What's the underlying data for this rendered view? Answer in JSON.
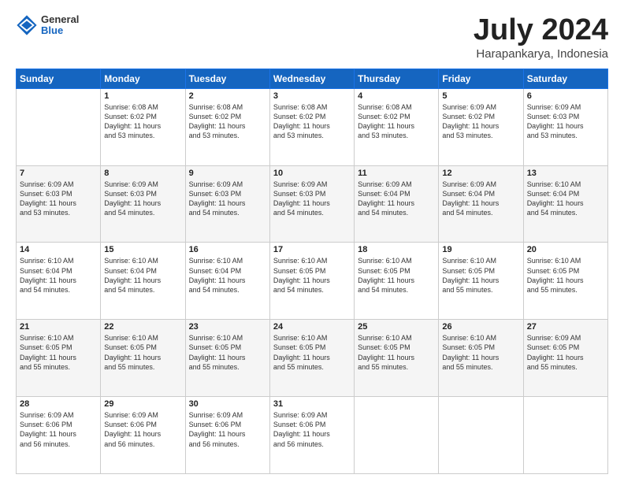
{
  "header": {
    "logo_line1": "General",
    "logo_line2": "Blue",
    "main_title": "July 2024",
    "subtitle": "Harapankarya, Indonesia"
  },
  "calendar": {
    "days_of_week": [
      "Sunday",
      "Monday",
      "Tuesday",
      "Wednesday",
      "Thursday",
      "Friday",
      "Saturday"
    ],
    "weeks": [
      [
        {
          "num": "",
          "lines": []
        },
        {
          "num": "1",
          "lines": [
            "Sunrise: 6:08 AM",
            "Sunset: 6:02 PM",
            "Daylight: 11 hours",
            "and 53 minutes."
          ]
        },
        {
          "num": "2",
          "lines": [
            "Sunrise: 6:08 AM",
            "Sunset: 6:02 PM",
            "Daylight: 11 hours",
            "and 53 minutes."
          ]
        },
        {
          "num": "3",
          "lines": [
            "Sunrise: 6:08 AM",
            "Sunset: 6:02 PM",
            "Daylight: 11 hours",
            "and 53 minutes."
          ]
        },
        {
          "num": "4",
          "lines": [
            "Sunrise: 6:08 AM",
            "Sunset: 6:02 PM",
            "Daylight: 11 hours",
            "and 53 minutes."
          ]
        },
        {
          "num": "5",
          "lines": [
            "Sunrise: 6:09 AM",
            "Sunset: 6:02 PM",
            "Daylight: 11 hours",
            "and 53 minutes."
          ]
        },
        {
          "num": "6",
          "lines": [
            "Sunrise: 6:09 AM",
            "Sunset: 6:03 PM",
            "Daylight: 11 hours",
            "and 53 minutes."
          ]
        }
      ],
      [
        {
          "num": "7",
          "lines": [
            "Sunrise: 6:09 AM",
            "Sunset: 6:03 PM",
            "Daylight: 11 hours",
            "and 53 minutes."
          ]
        },
        {
          "num": "8",
          "lines": [
            "Sunrise: 6:09 AM",
            "Sunset: 6:03 PM",
            "Daylight: 11 hours",
            "and 54 minutes."
          ]
        },
        {
          "num": "9",
          "lines": [
            "Sunrise: 6:09 AM",
            "Sunset: 6:03 PM",
            "Daylight: 11 hours",
            "and 54 minutes."
          ]
        },
        {
          "num": "10",
          "lines": [
            "Sunrise: 6:09 AM",
            "Sunset: 6:03 PM",
            "Daylight: 11 hours",
            "and 54 minutes."
          ]
        },
        {
          "num": "11",
          "lines": [
            "Sunrise: 6:09 AM",
            "Sunset: 6:04 PM",
            "Daylight: 11 hours",
            "and 54 minutes."
          ]
        },
        {
          "num": "12",
          "lines": [
            "Sunrise: 6:09 AM",
            "Sunset: 6:04 PM",
            "Daylight: 11 hours",
            "and 54 minutes."
          ]
        },
        {
          "num": "13",
          "lines": [
            "Sunrise: 6:10 AM",
            "Sunset: 6:04 PM",
            "Daylight: 11 hours",
            "and 54 minutes."
          ]
        }
      ],
      [
        {
          "num": "14",
          "lines": [
            "Sunrise: 6:10 AM",
            "Sunset: 6:04 PM",
            "Daylight: 11 hours",
            "and 54 minutes."
          ]
        },
        {
          "num": "15",
          "lines": [
            "Sunrise: 6:10 AM",
            "Sunset: 6:04 PM",
            "Daylight: 11 hours",
            "and 54 minutes."
          ]
        },
        {
          "num": "16",
          "lines": [
            "Sunrise: 6:10 AM",
            "Sunset: 6:04 PM",
            "Daylight: 11 hours",
            "and 54 minutes."
          ]
        },
        {
          "num": "17",
          "lines": [
            "Sunrise: 6:10 AM",
            "Sunset: 6:05 PM",
            "Daylight: 11 hours",
            "and 54 minutes."
          ]
        },
        {
          "num": "18",
          "lines": [
            "Sunrise: 6:10 AM",
            "Sunset: 6:05 PM",
            "Daylight: 11 hours",
            "and 54 minutes."
          ]
        },
        {
          "num": "19",
          "lines": [
            "Sunrise: 6:10 AM",
            "Sunset: 6:05 PM",
            "Daylight: 11 hours",
            "and 55 minutes."
          ]
        },
        {
          "num": "20",
          "lines": [
            "Sunrise: 6:10 AM",
            "Sunset: 6:05 PM",
            "Daylight: 11 hours",
            "and 55 minutes."
          ]
        }
      ],
      [
        {
          "num": "21",
          "lines": [
            "Sunrise: 6:10 AM",
            "Sunset: 6:05 PM",
            "Daylight: 11 hours",
            "and 55 minutes."
          ]
        },
        {
          "num": "22",
          "lines": [
            "Sunrise: 6:10 AM",
            "Sunset: 6:05 PM",
            "Daylight: 11 hours",
            "and 55 minutes."
          ]
        },
        {
          "num": "23",
          "lines": [
            "Sunrise: 6:10 AM",
            "Sunset: 6:05 PM",
            "Daylight: 11 hours",
            "and 55 minutes."
          ]
        },
        {
          "num": "24",
          "lines": [
            "Sunrise: 6:10 AM",
            "Sunset: 6:05 PM",
            "Daylight: 11 hours",
            "and 55 minutes."
          ]
        },
        {
          "num": "25",
          "lines": [
            "Sunrise: 6:10 AM",
            "Sunset: 6:05 PM",
            "Daylight: 11 hours",
            "and 55 minutes."
          ]
        },
        {
          "num": "26",
          "lines": [
            "Sunrise: 6:10 AM",
            "Sunset: 6:05 PM",
            "Daylight: 11 hours",
            "and 55 minutes."
          ]
        },
        {
          "num": "27",
          "lines": [
            "Sunrise: 6:09 AM",
            "Sunset: 6:05 PM",
            "Daylight: 11 hours",
            "and 55 minutes."
          ]
        }
      ],
      [
        {
          "num": "28",
          "lines": [
            "Sunrise: 6:09 AM",
            "Sunset: 6:06 PM",
            "Daylight: 11 hours",
            "and 56 minutes."
          ]
        },
        {
          "num": "29",
          "lines": [
            "Sunrise: 6:09 AM",
            "Sunset: 6:06 PM",
            "Daylight: 11 hours",
            "and 56 minutes."
          ]
        },
        {
          "num": "30",
          "lines": [
            "Sunrise: 6:09 AM",
            "Sunset: 6:06 PM",
            "Daylight: 11 hours",
            "and 56 minutes."
          ]
        },
        {
          "num": "31",
          "lines": [
            "Sunrise: 6:09 AM",
            "Sunset: 6:06 PM",
            "Daylight: 11 hours",
            "and 56 minutes."
          ]
        },
        {
          "num": "",
          "lines": []
        },
        {
          "num": "",
          "lines": []
        },
        {
          "num": "",
          "lines": []
        }
      ]
    ]
  }
}
